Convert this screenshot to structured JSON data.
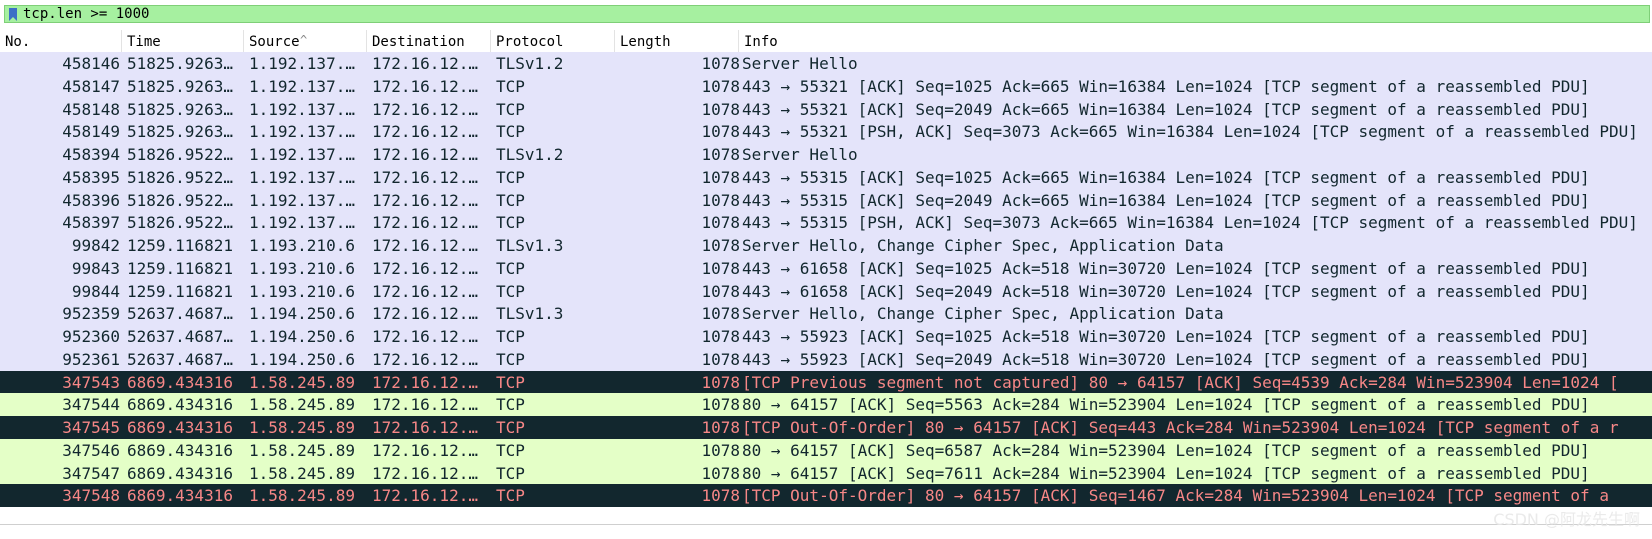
{
  "filter": {
    "value": "tcp.len >= 1000"
  },
  "columns": [
    {
      "key": "no",
      "label": "No."
    },
    {
      "key": "time",
      "label": "Time"
    },
    {
      "key": "source",
      "label": "Source"
    },
    {
      "key": "destination",
      "label": "Destination"
    },
    {
      "key": "protocol",
      "label": "Protocol"
    },
    {
      "key": "length",
      "label": "Length"
    },
    {
      "key": "info",
      "label": "Info"
    }
  ],
  "sort_indicator": "^",
  "row_styles": {
    "tls": {
      "bg": "#e4e4fa",
      "fg": "#12272e"
    },
    "green": {
      "bg": "#e4ffc7",
      "fg": "#12272e"
    },
    "bad": {
      "bg": "#12272e",
      "fg": "#f78787"
    }
  },
  "packets": [
    {
      "no": "458146",
      "time": "51825.9263…",
      "source": "1.192.137.…",
      "destination": "172.16.12.…",
      "protocol": "TLSv1.2",
      "length": "1078",
      "info": "Server Hello",
      "style": "tls"
    },
    {
      "no": "458147",
      "time": "51825.9263…",
      "source": "1.192.137.…",
      "destination": "172.16.12.…",
      "protocol": "TCP",
      "length": "1078",
      "info": "443 → 55321 [ACK] Seq=1025 Ack=665 Win=16384 Len=1024 [TCP segment of a reassembled PDU]",
      "style": "tls"
    },
    {
      "no": "458148",
      "time": "51825.9263…",
      "source": "1.192.137.…",
      "destination": "172.16.12.…",
      "protocol": "TCP",
      "length": "1078",
      "info": "443 → 55321 [ACK] Seq=2049 Ack=665 Win=16384 Len=1024 [TCP segment of a reassembled PDU]",
      "style": "tls"
    },
    {
      "no": "458149",
      "time": "51825.9263…",
      "source": "1.192.137.…",
      "destination": "172.16.12.…",
      "protocol": "TCP",
      "length": "1078",
      "info": "443 → 55321 [PSH, ACK] Seq=3073 Ack=665 Win=16384 Len=1024 [TCP segment of a reassembled PDU]",
      "style": "tls"
    },
    {
      "no": "458394",
      "time": "51826.9522…",
      "source": "1.192.137.…",
      "destination": "172.16.12.…",
      "protocol": "TLSv1.2",
      "length": "1078",
      "info": "Server Hello",
      "style": "tls"
    },
    {
      "no": "458395",
      "time": "51826.9522…",
      "source": "1.192.137.…",
      "destination": "172.16.12.…",
      "protocol": "TCP",
      "length": "1078",
      "info": "443 → 55315 [ACK] Seq=1025 Ack=665 Win=16384 Len=1024 [TCP segment of a reassembled PDU]",
      "style": "tls"
    },
    {
      "no": "458396",
      "time": "51826.9522…",
      "source": "1.192.137.…",
      "destination": "172.16.12.…",
      "protocol": "TCP",
      "length": "1078",
      "info": "443 → 55315 [ACK] Seq=2049 Ack=665 Win=16384 Len=1024 [TCP segment of a reassembled PDU]",
      "style": "tls"
    },
    {
      "no": "458397",
      "time": "51826.9522…",
      "source": "1.192.137.…",
      "destination": "172.16.12.…",
      "protocol": "TCP",
      "length": "1078",
      "info": "443 → 55315 [PSH, ACK] Seq=3073 Ack=665 Win=16384 Len=1024 [TCP segment of a reassembled PDU]",
      "style": "tls"
    },
    {
      "no": "99842",
      "time": "1259.116821",
      "source": "1.193.210.6",
      "destination": "172.16.12.…",
      "protocol": "TLSv1.3",
      "length": "1078",
      "info": "Server Hello, Change Cipher Spec, Application Data",
      "style": "tls"
    },
    {
      "no": "99843",
      "time": "1259.116821",
      "source": "1.193.210.6",
      "destination": "172.16.12.…",
      "protocol": "TCP",
      "length": "1078",
      "info": "443 → 61658 [ACK] Seq=1025 Ack=518 Win=30720 Len=1024 [TCP segment of a reassembled PDU]",
      "style": "tls"
    },
    {
      "no": "99844",
      "time": "1259.116821",
      "source": "1.193.210.6",
      "destination": "172.16.12.…",
      "protocol": "TCP",
      "length": "1078",
      "info": "443 → 61658 [ACK] Seq=2049 Ack=518 Win=30720 Len=1024 [TCP segment of a reassembled PDU]",
      "style": "tls"
    },
    {
      "no": "952359",
      "time": "52637.4687…",
      "source": "1.194.250.6",
      "destination": "172.16.12.…",
      "protocol": "TLSv1.3",
      "length": "1078",
      "info": "Server Hello, Change Cipher Spec, Application Data",
      "style": "tls"
    },
    {
      "no": "952360",
      "time": "52637.4687…",
      "source": "1.194.250.6",
      "destination": "172.16.12.…",
      "protocol": "TCP",
      "length": "1078",
      "info": "443 → 55923 [ACK] Seq=1025 Ack=518 Win=30720 Len=1024 [TCP segment of a reassembled PDU]",
      "style": "tls"
    },
    {
      "no": "952361",
      "time": "52637.4687…",
      "source": "1.194.250.6",
      "destination": "172.16.12.…",
      "protocol": "TCP",
      "length": "1078",
      "info": "443 → 55923 [ACK] Seq=2049 Ack=518 Win=30720 Len=1024 [TCP segment of a reassembled PDU]",
      "style": "tls"
    },
    {
      "no": "347543",
      "time": "6869.434316",
      "source": "1.58.245.89",
      "destination": "172.16.12.…",
      "protocol": "TCP",
      "length": "1078",
      "info": "[TCP Previous segment not captured] 80 → 64157 [ACK] Seq=4539 Ack=284 Win=523904 Len=1024 [",
      "style": "bad"
    },
    {
      "no": "347544",
      "time": "6869.434316",
      "source": "1.58.245.89",
      "destination": "172.16.12.…",
      "protocol": "TCP",
      "length": "1078",
      "info": "80 → 64157 [ACK] Seq=5563 Ack=284 Win=523904 Len=1024 [TCP segment of a reassembled PDU]",
      "style": "green"
    },
    {
      "no": "347545",
      "time": "6869.434316",
      "source": "1.58.245.89",
      "destination": "172.16.12.…",
      "protocol": "TCP",
      "length": "1078",
      "info": "[TCP Out-Of-Order] 80 → 64157 [ACK] Seq=443 Ack=284 Win=523904 Len=1024 [TCP segment of a r",
      "style": "bad"
    },
    {
      "no": "347546",
      "time": "6869.434316",
      "source": "1.58.245.89",
      "destination": "172.16.12.…",
      "protocol": "TCP",
      "length": "1078",
      "info": "80 → 64157 [ACK] Seq=6587 Ack=284 Win=523904 Len=1024 [TCP segment of a reassembled PDU]",
      "style": "green"
    },
    {
      "no": "347547",
      "time": "6869.434316",
      "source": "1.58.245.89",
      "destination": "172.16.12.…",
      "protocol": "TCP",
      "length": "1078",
      "info": "80 → 64157 [ACK] Seq=7611 Ack=284 Win=523904 Len=1024 [TCP segment of a reassembled PDU]",
      "style": "green"
    },
    {
      "no": "347548",
      "time": "6869.434316",
      "source": "1.58.245.89",
      "destination": "172.16.12.…",
      "protocol": "TCP",
      "length": "1078",
      "info": "[TCP Out-Of-Order] 80 → 64157 [ACK] Seq=1467 Ack=284 Win=523904 Len=1024 [TCP segment of a",
      "style": "bad"
    }
  ],
  "watermark": "CSDN @阿龙先生啊"
}
